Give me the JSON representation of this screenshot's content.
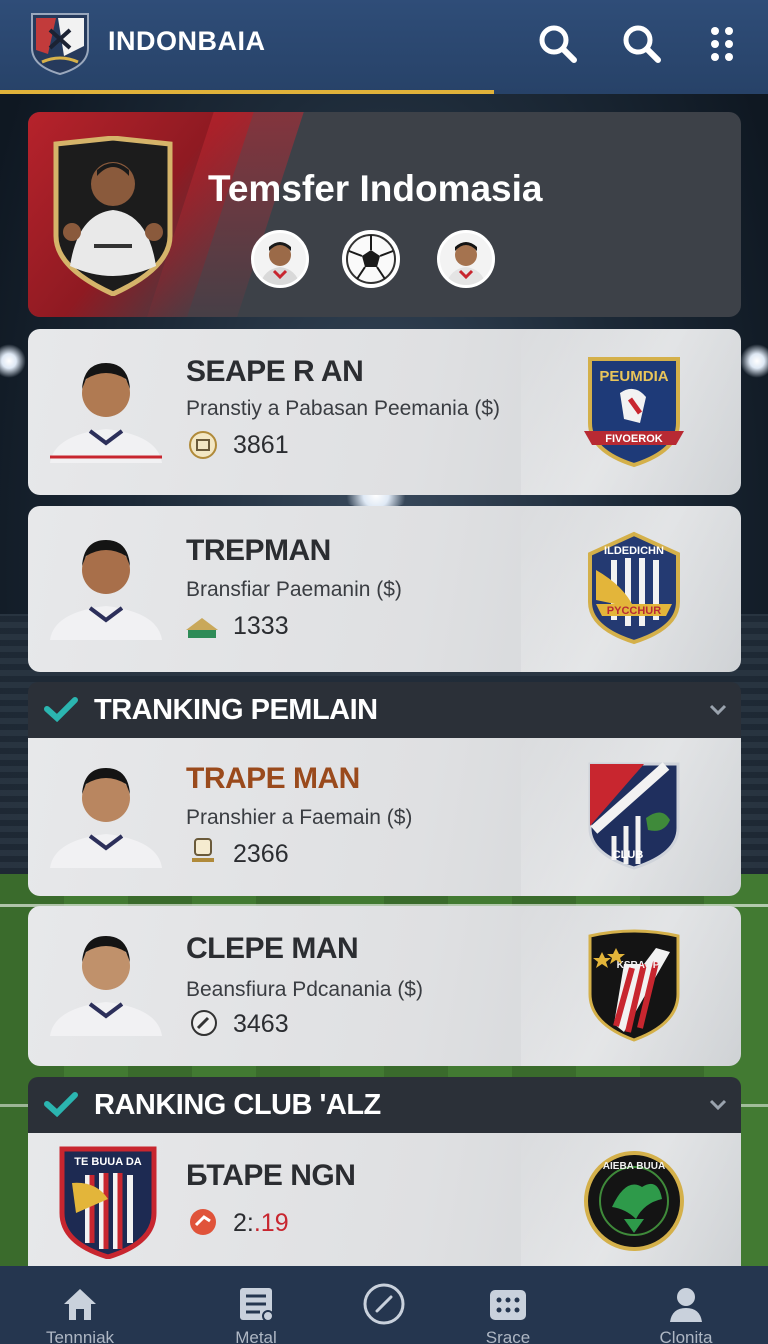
{
  "app": {
    "title": "INDONBAIA"
  },
  "header": {
    "actions": [
      "search-icon",
      "search-icon",
      "more-vertical-icon"
    ]
  },
  "hero": {
    "title": "Temsfer Indomasia",
    "avatars": [
      "player-avatar",
      "soccer-ball-icon",
      "player-avatar"
    ]
  },
  "transfers": [
    {
      "name": "SEAPE R AN",
      "subtitle": "Pranstiy a Pabasan Peemania ($)",
      "value": "3861",
      "crest_text": "PEUMDIA",
      "crest_banner": "FIVOEROK"
    },
    {
      "name": "TREPMAN",
      "subtitle": "Bransfiar Paemanin ($)",
      "value": "1333",
      "crest_text": "ILDEDICHN",
      "crest_banner": "PYCCHUR"
    }
  ],
  "sections": {
    "player_ranking": "TRANKING PEMLAIN",
    "club_ranking": "RANKING CLUB 'ALZ"
  },
  "rankings": [
    {
      "name": "TRAPE MAN",
      "subtitle": "Pranshier a Faemain ($)",
      "value": "2366",
      "crest_text": "CLUB"
    },
    {
      "name": "CLEPE MAN",
      "subtitle": "Beansfiura Pdcanania ($)",
      "value": "3463",
      "crest_text": "KSRAOP"
    }
  ],
  "club_row": {
    "name": "БТАРЕ NGN",
    "value_prefix": "2:",
    "value_suffix": ".19",
    "left_crest_text": "TE BUUA DA",
    "right_crest_text": "AIEBA BUUA"
  },
  "nav": [
    {
      "label": "Tennniak",
      "icon": "home-icon"
    },
    {
      "label": "Metal",
      "icon": "list-icon"
    },
    {
      "label": "",
      "icon": "compass-icon"
    },
    {
      "label": "Srace",
      "icon": "grid-icon"
    },
    {
      "label": "Clonita",
      "icon": "user-icon"
    }
  ],
  "colors": {
    "header": "#2f4d78",
    "accent_gold": "#e0b23a",
    "check_teal": "#2bb5b0",
    "red": "#c8262f"
  }
}
